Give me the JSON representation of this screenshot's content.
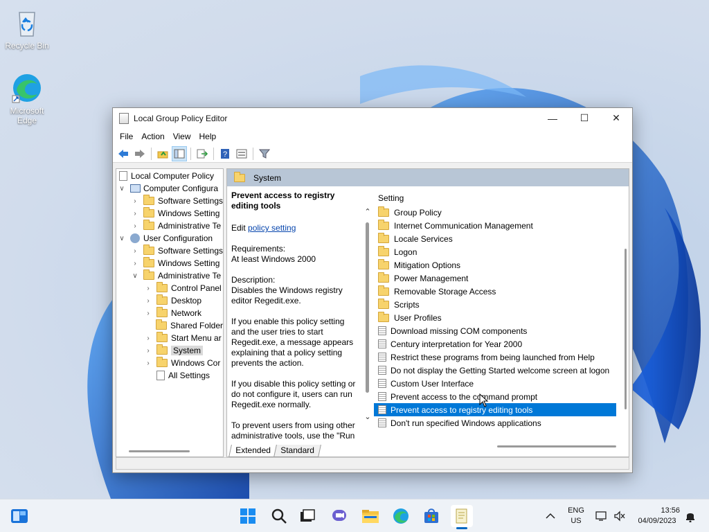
{
  "desktop": {
    "icons": [
      {
        "label": "Recycle Bin",
        "icon": "recycle-bin-icon"
      },
      {
        "label": "Microsoft Edge",
        "icon": "edge-icon"
      }
    ]
  },
  "window": {
    "title": "Local Group Policy Editor",
    "controls": {
      "minimize": "—",
      "maximize": "☐",
      "close": "✕"
    },
    "menu": [
      "File",
      "Action",
      "View",
      "Help"
    ],
    "toolbar_icons": [
      "back-icon",
      "forward-icon",
      "up-folder-icon",
      "show-hide-tree-icon",
      "export-list-icon",
      "help-icon",
      "properties-icon",
      "filter-icon"
    ]
  },
  "tree": {
    "root": "Local Computer Policy",
    "items": [
      {
        "label": "Computer Configura",
        "level": 1,
        "chev": "∨",
        "icon": "pc"
      },
      {
        "label": "Software Settings",
        "level": 2,
        "chev": "›",
        "icon": "folder"
      },
      {
        "label": "Windows Setting",
        "level": 2,
        "chev": "›",
        "icon": "folder"
      },
      {
        "label": "Administrative Te",
        "level": 2,
        "chev": "›",
        "icon": "folder"
      },
      {
        "label": "User Configuration",
        "level": 1,
        "chev": "∨",
        "icon": "user"
      },
      {
        "label": "Software Settings",
        "level": 2,
        "chev": "›",
        "icon": "folder"
      },
      {
        "label": "Windows Setting",
        "level": 2,
        "chev": "›",
        "icon": "folder"
      },
      {
        "label": "Administrative Te",
        "level": 2,
        "chev": "∨",
        "icon": "folder"
      },
      {
        "label": "Control Panel",
        "level": 3,
        "chev": "›",
        "icon": "folder"
      },
      {
        "label": "Desktop",
        "level": 3,
        "chev": "›",
        "icon": "folder"
      },
      {
        "label": "Network",
        "level": 3,
        "chev": "›",
        "icon": "folder"
      },
      {
        "label": "Shared Folder",
        "level": 3,
        "chev": "",
        "icon": "folder"
      },
      {
        "label": "Start Menu ar",
        "level": 3,
        "chev": "›",
        "icon": "folder"
      },
      {
        "label": "System",
        "level": 3,
        "chev": "›",
        "icon": "folder",
        "selected": true
      },
      {
        "label": "Windows Cor",
        "level": 3,
        "chev": "›",
        "icon": "folder"
      },
      {
        "label": "All Settings",
        "level": 3,
        "chev": "",
        "icon": "doc"
      }
    ]
  },
  "header": {
    "folder_name": "System"
  },
  "description": {
    "title": "Prevent access to registry editing tools",
    "edit_prefix": "Edit ",
    "edit_link": "policy setting",
    "requirements_label": "Requirements:",
    "requirements_value": "At least Windows 2000",
    "description_label": "Description:",
    "description_text": "Disables the Windows registry editor Regedit.exe.",
    "enable_text": "If you enable this policy setting and the user tries to start Regedit.exe, a message appears explaining that a policy setting prevents the action.",
    "disable_text": "If you disable this policy setting or do not configure it, users can run Regedit.exe normally.",
    "other_text": "To prevent users from using other administrative tools, use the \"Run"
  },
  "list": {
    "column_header": "Setting",
    "folders": [
      "Group Policy",
      "Internet Communication Management",
      "Locale Services",
      "Logon",
      "Mitigation Options",
      "Power Management",
      "Removable Storage Access",
      "Scripts",
      "User Profiles"
    ],
    "settings": [
      {
        "label": "Download missing COM components"
      },
      {
        "label": "Century interpretation for Year 2000"
      },
      {
        "label": "Restrict these programs from being launched from Help"
      },
      {
        "label": "Do not display the Getting Started welcome screen at logon"
      },
      {
        "label": "Custom User Interface"
      },
      {
        "label": "Prevent access to the command prompt"
      },
      {
        "label": "Prevent access to registry editing tools",
        "selected": true
      },
      {
        "label": "Don't run specified Windows applications"
      }
    ]
  },
  "tabs": [
    "Extended",
    "Standard"
  ],
  "taskbar": {
    "apps": [
      "widgets-icon",
      "start-icon",
      "search-icon",
      "task-view-icon",
      "chat-icon",
      "file-explorer-icon",
      "edge-icon",
      "store-icon",
      "group-policy-editor-icon"
    ],
    "language_line1": "ENG",
    "language_line2": "US",
    "time": "13:56",
    "date": "04/09/2023"
  },
  "colors": {
    "selection": "#0078d7",
    "header_band": "#b8c6d6",
    "accent": "#0067c0"
  }
}
